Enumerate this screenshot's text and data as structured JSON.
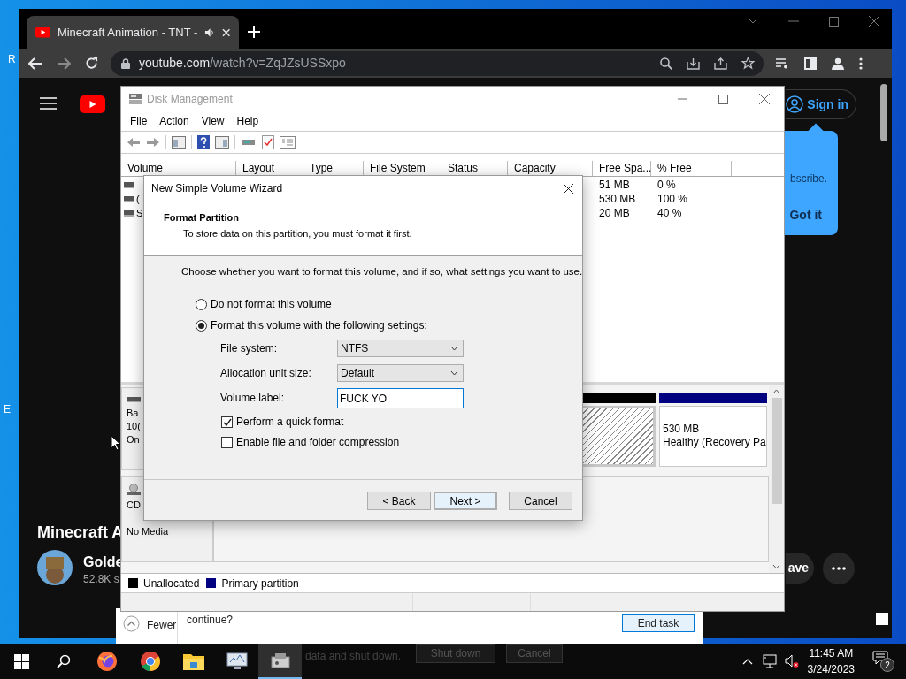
{
  "desktop": {
    "edge_labels": [
      "R",
      "E"
    ]
  },
  "browser": {
    "tab_title": "Minecraft Animation - TNT -",
    "url_host": "youtube.com",
    "url_path": "/watch?v=ZqJZsUSSxpo"
  },
  "youtube": {
    "sign_in": "Sign in",
    "tooltip_text": "bscribe.",
    "tooltip_button": "Got it",
    "video_title": "Minecraft A",
    "channel_name": "Golde",
    "subscribers": "52.8K s",
    "save_button": "ave"
  },
  "background_dialog": {
    "fewer_label": "Fewer",
    "question": "continue?",
    "end_task": "End task"
  },
  "shutdown_overlay": {
    "message": "data and shut down.",
    "buttons": [
      "Shut down",
      "Cancel"
    ]
  },
  "disk_management": {
    "title": "Disk Management",
    "menu": [
      "File",
      "Action",
      "View",
      "Help"
    ],
    "columns": [
      "Volume",
      "Layout",
      "Type",
      "File System",
      "Status",
      "Capacity",
      "Free Spa...",
      "% Free"
    ],
    "rows": [
      {
        "free_space": "51 MB",
        "percent_free": "0 %"
      },
      {
        "volume": "(",
        "free_space": "530 MB",
        "percent_free": "100 %"
      },
      {
        "volume": "S",
        "free_space": "20 MB",
        "percent_free": "40 %"
      }
    ],
    "disks": [
      {
        "kind": "basic",
        "lines": [
          "Ba",
          "10(",
          "On"
        ]
      },
      {
        "kind": "cdrom",
        "lines": [
          "CD",
          "No Media"
        ]
      }
    ],
    "partitions": [
      {
        "kind": "unallocated"
      },
      {
        "kind": "primary",
        "size": "530 MB",
        "status": "Healthy (Recovery Pa"
      }
    ],
    "legend": [
      {
        "label": "Unallocated",
        "color": "#000000"
      },
      {
        "label": "Primary partition",
        "color": "#000080"
      }
    ]
  },
  "wizard": {
    "title": "New Simple Volume Wizard",
    "heading": "Format Partition",
    "subheading": "To store data on this partition, you must format it first.",
    "instruction": "Choose whether you want to format this volume, and if so, what settings you want to use.",
    "options": [
      {
        "label": "Do not format this volume",
        "selected": false
      },
      {
        "label": "Format this volume with the following settings:",
        "selected": true
      }
    ],
    "file_system": {
      "label": "File system:",
      "value": "NTFS"
    },
    "allocation_unit_size": {
      "label": "Allocation unit size:",
      "value": "Default"
    },
    "volume_label": {
      "label": "Volume label:",
      "value": "FUCK YO"
    },
    "checkboxes": [
      {
        "label": "Perform a quick format",
        "checked": true
      },
      {
        "label": "Enable file and folder compression",
        "checked": false
      }
    ],
    "buttons": [
      "< Back",
      "Next >",
      "Cancel"
    ]
  },
  "taskbar": {
    "time": "11:45 AM",
    "date": "3/24/2023",
    "notifications": "2"
  }
}
